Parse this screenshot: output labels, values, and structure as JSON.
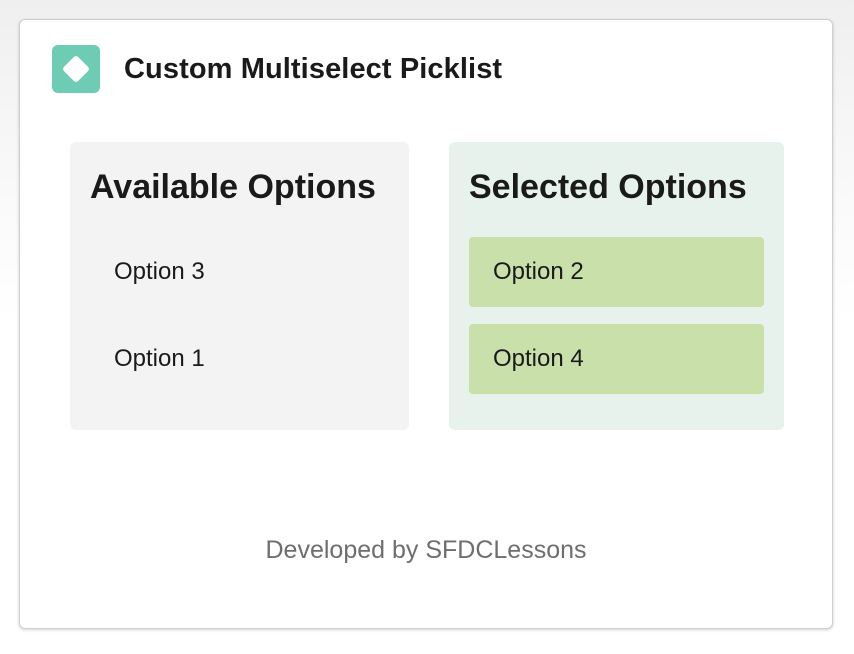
{
  "header": {
    "icon": "diamond-icon",
    "icon_color": "#6fccb4",
    "title": "Custom Multiselect Picklist"
  },
  "available": {
    "title": "Available Options",
    "background": "#f3f3f3",
    "items": [
      {
        "label": "Option 3"
      },
      {
        "label": "Option 1"
      }
    ]
  },
  "selected": {
    "title": "Selected Options",
    "background": "#e8f2ec",
    "item_background": "#cae0ab",
    "items": [
      {
        "label": "Option 2"
      },
      {
        "label": "Option 4"
      }
    ]
  },
  "footer": {
    "text": "Developed by SFDCLessons"
  }
}
